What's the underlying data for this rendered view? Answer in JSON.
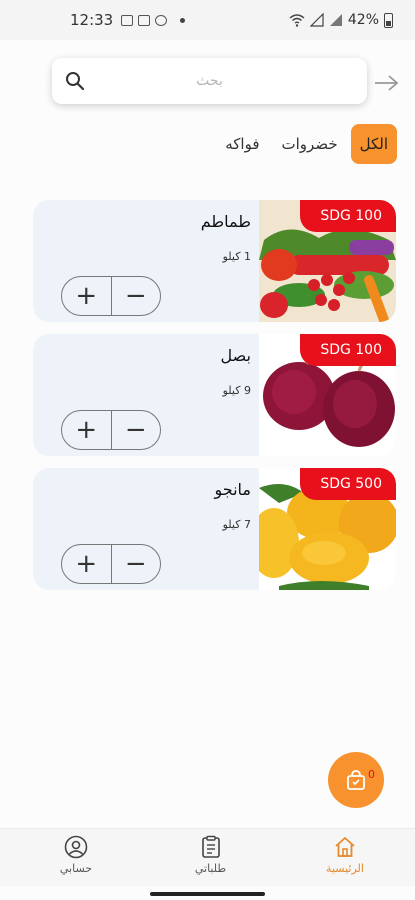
{
  "status_bar": {
    "time": "12:33",
    "battery": "42%"
  },
  "search": {
    "placeholder": "بحث",
    "value": ""
  },
  "tabs": [
    {
      "label": "الكل",
      "active": true
    },
    {
      "label": "خضروات",
      "active": false
    },
    {
      "label": "فواكه",
      "active": false
    }
  ],
  "products": [
    {
      "name": "طماطم",
      "weight": "1 كيلو",
      "price": "SDG 100",
      "image": "vegetables"
    },
    {
      "name": "بصل",
      "weight": "9 كيلو",
      "price": "SDG 100",
      "image": "red-onions"
    },
    {
      "name": "مانجو",
      "weight": "7 كيلو",
      "price": "SDG 500",
      "image": "mangoes"
    }
  ],
  "stepper": {
    "plus": "+",
    "minus": "−"
  },
  "cart": {
    "count": "0"
  },
  "bottom_nav": [
    {
      "label": "الرئيسية",
      "icon": "home-icon",
      "active": true
    },
    {
      "label": "طلباتي",
      "icon": "orders-icon",
      "active": false
    },
    {
      "label": "حسابي",
      "icon": "account-icon",
      "active": false
    }
  ],
  "colors": {
    "accent": "#f7922e",
    "price_badge": "#e8101a",
    "card_bg": "#eef3fa"
  }
}
